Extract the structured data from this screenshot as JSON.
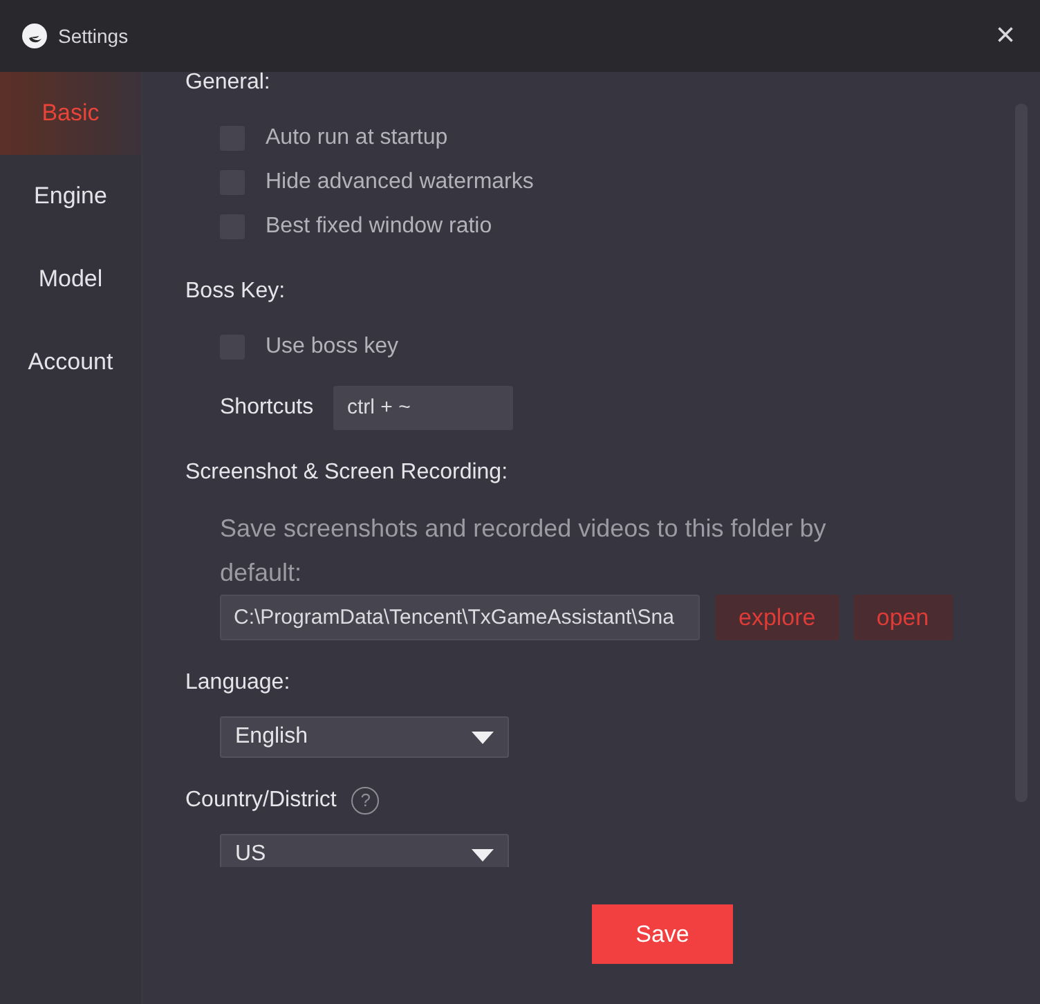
{
  "window": {
    "title": "Settings",
    "close": "×"
  },
  "sidebar": {
    "items": [
      {
        "label": "Basic",
        "selected": true
      },
      {
        "label": "Engine",
        "selected": false
      },
      {
        "label": "Model",
        "selected": false
      },
      {
        "label": "Account",
        "selected": false
      }
    ]
  },
  "sections": [
    {
      "title": "General:",
      "items": [
        {
          "kind": "checkbox",
          "label": "Auto run at startup",
          "checked": false
        },
        {
          "kind": "checkbox",
          "label": "Hide advanced watermarks",
          "checked": false
        },
        {
          "kind": "checkbox",
          "label": "Best fixed window ratio",
          "checked": false
        }
      ]
    },
    {
      "title": "Boss Key:",
      "items": [
        {
          "kind": "checkbox",
          "label": "Use boss key",
          "checked": false
        },
        {
          "kind": "shortcut",
          "label": "Shortcuts",
          "value": "ctrl + ~"
        }
      ]
    },
    {
      "title": "Screenshot & Screen Recording:",
      "items": [
        {
          "kind": "text",
          "text": "Save screenshots and recorded videos to this folder by default:"
        },
        {
          "kind": "path",
          "value": "C:\\ProgramData\\Tencent\\TxGameAssistant\\Sna",
          "buttons": [
            "explore",
            "open"
          ]
        }
      ]
    },
    {
      "title": "Language:",
      "items": [
        {
          "kind": "dropdown",
          "value": "English"
        }
      ]
    },
    {
      "title": "Country/District",
      "help": "?",
      "items": [
        {
          "kind": "dropdown",
          "value": "US"
        }
      ]
    }
  ],
  "footer": {
    "buttons": [
      "Save"
    ]
  }
}
